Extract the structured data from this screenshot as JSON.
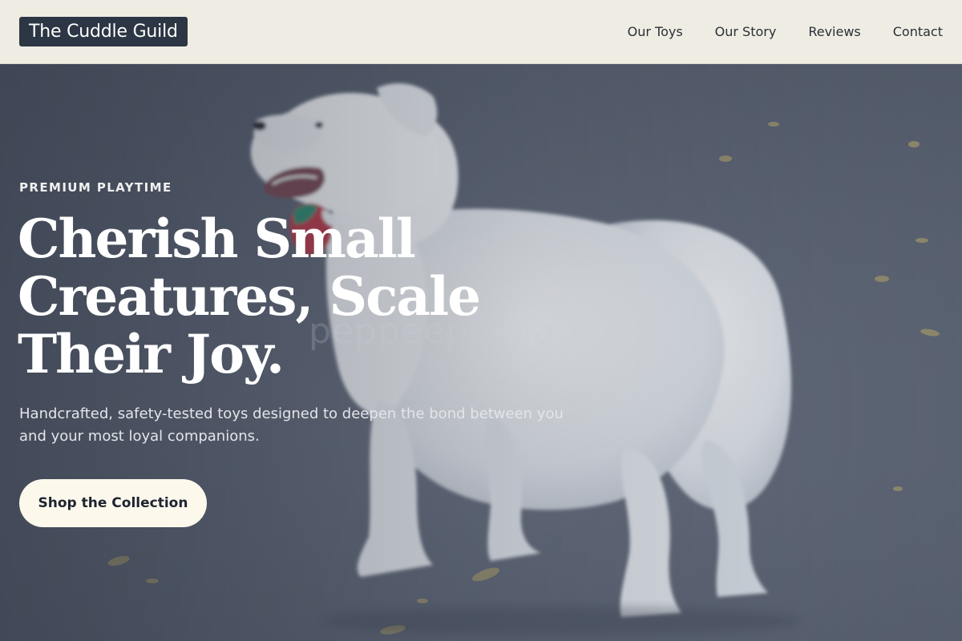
{
  "brand": {
    "name": "The Cuddle Guild"
  },
  "nav": {
    "items": [
      {
        "label": "Our Toys"
      },
      {
        "label": "Our Story"
      },
      {
        "label": "Reviews"
      },
      {
        "label": "Contact"
      }
    ]
  },
  "hero": {
    "eyebrow": "PREMIUM PLAYTIME",
    "headline_lines": [
      "Cherish Small",
      "Creatures, Scale",
      "Their Joy."
    ],
    "subtext": "Handcrafted, safety-tested toys designed to deepen the bond between you and your most loyal companions.",
    "cta_label": "Shop the Collection",
    "watermark": "peppeep.asia",
    "image": "white-samoyed-dog-with-toy-photo"
  },
  "colors": {
    "header_bg": "#efede3",
    "logo_bg": "#2c3644",
    "cta_bg": "#fcf8ec",
    "overlay": "#5d6573"
  }
}
